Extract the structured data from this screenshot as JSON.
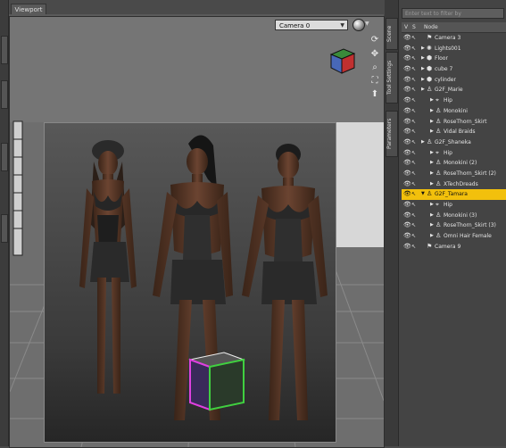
{
  "viewport": {
    "tab_label": "Viewport",
    "camera": "Camera 0",
    "nav_icons": [
      "orbit-icon",
      "pan-icon",
      "zoom-icon",
      "frame-icon",
      "reset-icon"
    ]
  },
  "scene_panel": {
    "side_tabs": [
      "Scene",
      "Tool Settings",
      "Parameters"
    ],
    "filter_placeholder": "Enter text to filter by",
    "col_v": "V",
    "col_s": "S",
    "col_node": "Node",
    "nodes": [
      {
        "label": "Camera 3",
        "depth": 0,
        "icon": "camera",
        "expand": false,
        "selected": false
      },
      {
        "label": "Lights001",
        "depth": 0,
        "icon": "light",
        "expand": true,
        "selected": false
      },
      {
        "label": "Floor",
        "depth": 0,
        "icon": "prop",
        "expand": true,
        "selected": false
      },
      {
        "label": "cube 7",
        "depth": 0,
        "icon": "prop",
        "expand": true,
        "selected": false
      },
      {
        "label": "cylinder",
        "depth": 0,
        "icon": "prop",
        "expand": true,
        "selected": false
      },
      {
        "label": "G2F_Marie",
        "depth": 0,
        "icon": "figure",
        "expand": true,
        "selected": false
      },
      {
        "label": "Hip",
        "depth": 1,
        "icon": "bone",
        "expand": true,
        "selected": false
      },
      {
        "label": "Monokini",
        "depth": 1,
        "icon": "figure",
        "expand": true,
        "selected": false
      },
      {
        "label": "RoseThorn_Skirt",
        "depth": 1,
        "icon": "figure",
        "expand": true,
        "selected": false
      },
      {
        "label": "Vidal Braids",
        "depth": 1,
        "icon": "figure",
        "expand": true,
        "selected": false
      },
      {
        "label": "G2F_Shaneka",
        "depth": 0,
        "icon": "figure",
        "expand": true,
        "selected": false
      },
      {
        "label": "Hip",
        "depth": 1,
        "icon": "bone",
        "expand": true,
        "selected": false
      },
      {
        "label": "Monokini (2)",
        "depth": 1,
        "icon": "figure",
        "expand": true,
        "selected": false
      },
      {
        "label": "RoseThorn_Skirt (2)",
        "depth": 1,
        "icon": "figure",
        "expand": true,
        "selected": false
      },
      {
        "label": "XTechDreads",
        "depth": 1,
        "icon": "figure",
        "expand": true,
        "selected": false
      },
      {
        "label": "G2F_Tamara",
        "depth": 0,
        "icon": "figure",
        "expand": true,
        "selected": true
      },
      {
        "label": "Hip",
        "depth": 1,
        "icon": "bone",
        "expand": true,
        "selected": false
      },
      {
        "label": "Monokini (3)",
        "depth": 1,
        "icon": "figure",
        "expand": true,
        "selected": false
      },
      {
        "label": "RoseThorn_Skirt (3)",
        "depth": 1,
        "icon": "figure",
        "expand": true,
        "selected": false
      },
      {
        "label": "Omni Hair Female",
        "depth": 1,
        "icon": "figure",
        "expand": true,
        "selected": false
      },
      {
        "label": "Camera 9",
        "depth": 0,
        "icon": "camera",
        "expand": false,
        "selected": false
      }
    ]
  },
  "colors": {
    "selection": "#f2c00c",
    "panel_bg": "#444444",
    "viewport_bg": "#707070"
  }
}
